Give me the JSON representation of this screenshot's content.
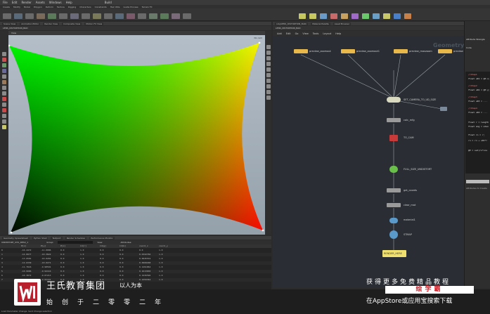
{
  "menubar": {
    "items": [
      "File",
      "Edit",
      "Render",
      "Assets",
      "Windows",
      "Help"
    ],
    "desktop": "Build"
  },
  "toolbar": {
    "items": [
      "Create",
      "Modify",
      "Model",
      "Polygon",
      "Deform",
      "Texture",
      "Rigging",
      "Characters",
      "Constraints",
      "Hair Utils",
      "Guide Process",
      "Terrain FX"
    ]
  },
  "shelf_tools": [
    "Box",
    "Sphere",
    "Tube",
    "Torus",
    "Grid",
    "Null",
    "Line",
    "Circle",
    "Curve",
    "Draw Curve",
    "Path",
    "Spray Paint",
    "Font",
    "Platonic Solids",
    "L-System",
    "Metaball",
    "File"
  ],
  "right_shelf_tabs": [
    "Lights and Cameras",
    "Collisions",
    "Particles",
    "Grains",
    "Vellum",
    "Rigid Bodies",
    "Particle Fluids",
    "Viscous Fluids",
    "Oceans",
    "Pyro FX"
  ],
  "viewport": {
    "pane_tabs": [
      "Scene View",
      "Animation Editor",
      "Render View",
      "Composite View",
      "Motion FX View"
    ],
    "path": "LENS_DISTORTION_BAD",
    "view_label": "View",
    "persp": "No cam"
  },
  "network": {
    "pane_tabs": [
      "/obj/LENS_DISTORTION_BAD/",
      "Material Palette",
      "Asset Browser"
    ],
    "path": "LENS_DISTORTION_BAD",
    "menu": [
      "Add",
      "Edit",
      "Go",
      "View",
      "Tools",
      "Layout",
      "Help"
    ],
    "context_label": "Geometry",
    "nodes": [
      {
        "name": "preview_zoomout",
        "color": "#e8b84a"
      },
      {
        "name": "preview_zoomout1",
        "color": "#e8b84a"
      },
      {
        "name": "preview_maxzoom",
        "color": "#e8b84a"
      },
      {
        "name": "preview",
        "color": "#e8b84a"
      },
      {
        "name": "SET_CAMERA_TO_UD_SIZE",
        "color": "#d9d9c0"
      },
      {
        "name": "calc_mfg",
        "color": "#9a9a9a"
      },
      {
        "name": "TO_CAM",
        "color": "#c83a3a"
      },
      {
        "name": "FULL_SIZE_UNDISTORT",
        "color": "#6abf4a"
      },
      {
        "name": "get_coords",
        "color": "#9a9a9a"
      },
      {
        "name": "clear_mat",
        "color": "#9a9a9a"
      },
      {
        "name": "material1",
        "color": "#5a9acb"
      },
      {
        "name": "STMAP",
        "color": "#5a9acb"
      },
      {
        "name": "RENDER_HERE",
        "color": "#f0e070"
      }
    ]
  },
  "code": {
    "header": "Attribute Wrangle",
    "tab": "Code",
    "lines": [
      "//Step1",
      "float u01 = @P.x;",
      "//Step2",
      "float u02 = @P.y;",
      "//Step3",
      "float u03 = ...",
      "//Step4",
      "float u04 = ...",
      "float r = length",
      "float ang = atan",
      "float rn = r;",
      "rn = rn + u01*r",
      "@P = set(rn*cos"
    ],
    "footer": "Attributes to Create"
  },
  "spreadsheet": {
    "pane_tabs": [
      "Geometry Spreadsheet",
      "Python Shell",
      "Textport",
      "Render Scheduler",
      "Performance Monitor"
    ],
    "node": "UNDISTORT_UVS_DESC_1",
    "group_label": "Group:",
    "view_label": "View",
    "attr_label": "Attributes:",
    "columns": [
      "",
      "P[x]",
      "P[y]",
      "P[z]",
      "Cd[r]",
      "Cd[g]",
      "Cd[b]",
      "coord_x",
      "coord_y"
    ],
    "rows": [
      [
        "0",
        "-16.4472",
        "-11.0006",
        "0.0",
        "1.0",
        "0.0",
        "0.0",
        "0.0",
        "1.0"
      ],
      [
        "1",
        "-14.8977",
        "-10.3822",
        "0.0",
        "1.0",
        "0.0",
        "0.0",
        "0.0322766",
        "1.0"
      ],
      [
        "2",
        "-13.6581",
        "-10.0201",
        "0.0",
        "1.0",
        "0.0",
        "0.0",
        "0.0645532",
        "1.0"
      ],
      [
        "3",
        "-12.6339",
        "-10.0271",
        "0.0",
        "1.0",
        "0.0",
        "0.0",
        "0.0968298",
        "1.0"
      ],
      [
        "4",
        "-11.7616",
        "-9.98591",
        "0.0",
        "1.0",
        "0.0",
        "0.0",
        "0.1291064",
        "1.0"
      ],
      [
        "5",
        "-10.9906",
        "-9.92116",
        "0.0",
        "1.0",
        "0.0",
        "0.0",
        "0.1613830",
        "1.0"
      ],
      [
        "6",
        "-10.3072",
        "-9.87213",
        "0.0",
        "1.0",
        "0.0",
        "0.0",
        "0.1936596",
        "1.0"
      ],
      [
        "7",
        "-9.68217",
        "-9.82441",
        "0.0",
        "1.0",
        "0.0",
        "0.0",
        "0.2259362",
        "1.0"
      ]
    ]
  },
  "watermark": {
    "company": "王氏教育集团",
    "motto": "以人为本",
    "slogan": "始创于二零零二年",
    "promo_line1": "获得更多免费精品教程",
    "promo_brand": "绘学霸",
    "promo_line3": "在AppStore或应用宝搜索下载"
  },
  "footer": {
    "text": "Load Parameter Change: Sent Change selection"
  },
  "colors": {
    "accent": "#e8b84a",
    "bg": "#2b2b2b",
    "watermark_red": "#b8202e"
  }
}
